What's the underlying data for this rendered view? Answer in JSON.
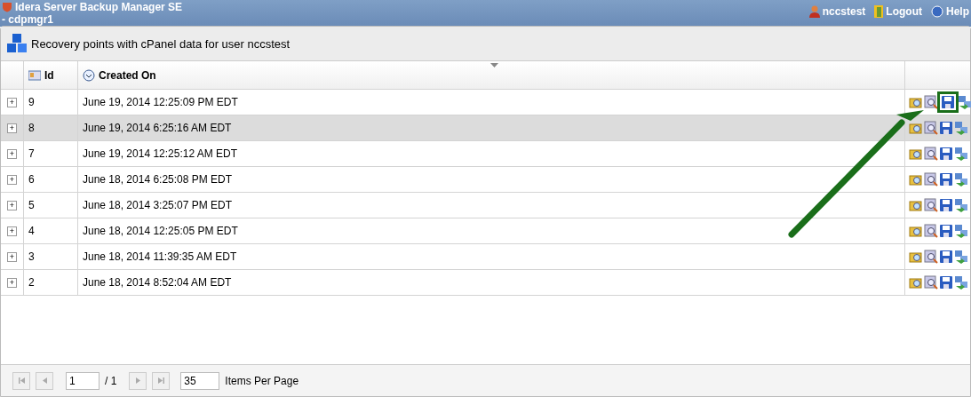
{
  "app": {
    "title": "Idera Server Backup Manager SE",
    "subtitle": "- cdpmgr1",
    "user": "nccstest",
    "logout": "Logout",
    "help": "Help"
  },
  "panel": {
    "title": "Recovery points with cPanel data for user nccstest"
  },
  "table": {
    "columns": [
      "Id",
      "Created On"
    ],
    "rows": [
      {
        "expand": "+",
        "id": "9",
        "created": "June 19, 2014 12:25:09 PM EDT",
        "selected": false,
        "marked": true
      },
      {
        "expand": "+",
        "id": "8",
        "created": "June 19, 2014 6:25:16 AM EDT",
        "selected": true,
        "marked": false
      },
      {
        "expand": "+",
        "id": "7",
        "created": "June 19, 2014 12:25:12 AM EDT",
        "selected": false,
        "marked": false
      },
      {
        "expand": "+",
        "id": "6",
        "created": "June 18, 2014 6:25:08 PM EDT",
        "selected": false,
        "marked": false
      },
      {
        "expand": "+",
        "id": "5",
        "created": "June 18, 2014 3:25:07 PM EDT",
        "selected": false,
        "marked": false
      },
      {
        "expand": "+",
        "id": "4",
        "created": "June 18, 2014 12:25:05 PM EDT",
        "selected": false,
        "marked": false
      },
      {
        "expand": "+",
        "id": "3",
        "created": "June 18, 2014 11:39:35 AM EDT",
        "selected": false,
        "marked": false
      },
      {
        "expand": "+",
        "id": "2",
        "created": "June 18, 2014 8:52:04 AM EDT",
        "selected": false,
        "marked": false
      }
    ]
  },
  "pager": {
    "page": "1",
    "total": "/ 1",
    "per_page": "35",
    "per_page_label": "Items Per Page"
  }
}
